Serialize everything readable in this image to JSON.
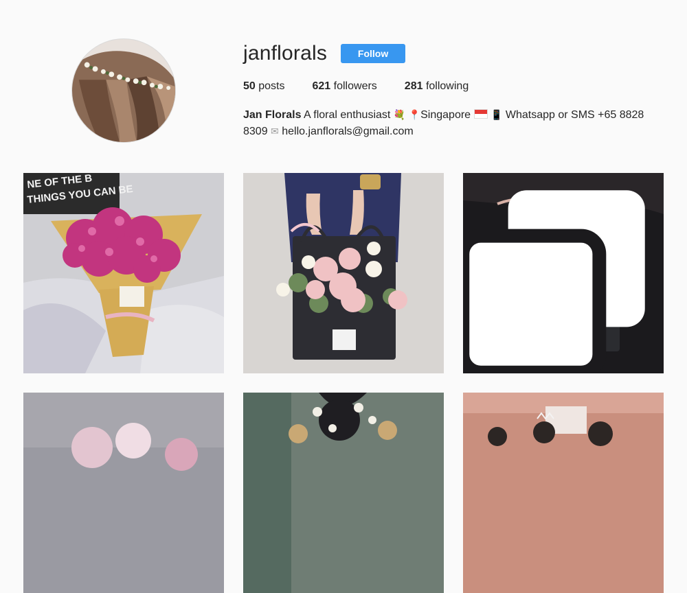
{
  "profile": {
    "username": "janflorals",
    "follow_label": "Follow",
    "avatar_alt": "avatar"
  },
  "stats": {
    "posts_count": "50",
    "posts_label": "posts",
    "followers_count": "621",
    "followers_label": "followers",
    "following_count": "281",
    "following_label": "following"
  },
  "bio": {
    "name": "Jan Florals",
    "text1": "A floral enthusiast",
    "icon1": "bouquet-emoji",
    "icon2": "pin-emoji",
    "text2": "Singapore",
    "icon3": "singapore-flag-emoji",
    "icon4": "phone-emoji",
    "text3": "Whatsapp or SMS +65 8828 8309",
    "icon5": "envelope-emoji",
    "text4": "hello.janflorals@gmail.com"
  },
  "posts": [
    {
      "name": "post-pink-gypsophila-bouquet",
      "multi": false,
      "sign": "NE OF THE B\nTHINGS YOU CAN BE"
    },
    {
      "name": "post-flower-box-held",
      "multi": false
    },
    {
      "name": "post-lit-flower-box",
      "multi": true
    },
    {
      "name": "post-4",
      "multi": false
    },
    {
      "name": "post-5",
      "multi": false
    },
    {
      "name": "post-6",
      "multi": false
    }
  ],
  "colors": {
    "accent": "#3897f0",
    "background": "#fafafa",
    "text": "#262626"
  }
}
